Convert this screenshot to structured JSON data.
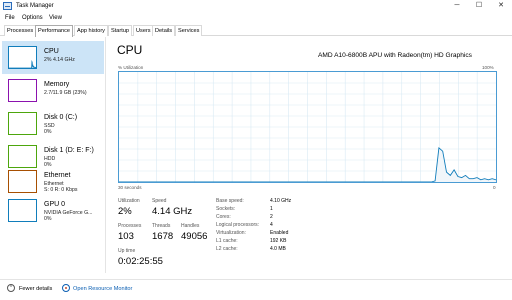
{
  "window": {
    "title": "Task Manager",
    "controls": {
      "minimize": "─",
      "maximize": "☐",
      "close": "✕"
    }
  },
  "menu": [
    "File",
    "Options",
    "View"
  ],
  "tabs": [
    {
      "label": "Processes",
      "active": false
    },
    {
      "label": "Performance",
      "active": true
    },
    {
      "label": "App history",
      "active": false
    },
    {
      "label": "Startup",
      "active": false
    },
    {
      "label": "Users",
      "active": false
    },
    {
      "label": "Details",
      "active": false
    },
    {
      "label": "Services",
      "active": false
    }
  ],
  "sidebar": [
    {
      "title": "CPU",
      "sub": "2% 4.14 GHz",
      "sub2": "",
      "color": "#117dbb",
      "selected": true
    },
    {
      "title": "Memory",
      "sub": "2.7/11.9 GB (23%)",
      "sub2": "",
      "color": "#8b12ae",
      "selected": false
    },
    {
      "title": "Disk 0 (C:)",
      "sub": "SSD",
      "sub2": "0%",
      "color": "#4da60c",
      "selected": false
    },
    {
      "title": "Disk 1 (D: E: F:)",
      "sub": "HDD",
      "sub2": "0%",
      "color": "#4da60c",
      "selected": false
    },
    {
      "title": "Ethernet",
      "sub": "Ethernet",
      "sub2": "S: 0 R: 0 Kbps",
      "color": "#a74f01",
      "selected": false
    },
    {
      "title": "GPU 0",
      "sub": "NVIDIA GeForce G...",
      "sub2": "0%",
      "color": "#117dbb",
      "selected": false
    }
  ],
  "main": {
    "title": "CPU",
    "model": "AMD A10-6800B APU with Radeon(tm) HD Graphics",
    "graph": {
      "y_label": "% Utilization",
      "y_max_label": "100%",
      "x_left_label": "30 seconds",
      "x_right_label": "0",
      "line_color": "#117dbb",
      "fill_color": "#f1f6fa",
      "grid_color": "#d9eaf4",
      "utilization_series": [
        0,
        0,
        0,
        0,
        0,
        0,
        0,
        0,
        0,
        0,
        0,
        0,
        0,
        0,
        0,
        0,
        0,
        0,
        0,
        0,
        0,
        0,
        0,
        0,
        0,
        0,
        0,
        0,
        0,
        0,
        0,
        0,
        0,
        0,
        0,
        0,
        0,
        0,
        0,
        0,
        0,
        0,
        0,
        0,
        0,
        0,
        0,
        0,
        0,
        0,
        0,
        0,
        0,
        0,
        0,
        0,
        0,
        0,
        0,
        0,
        0,
        0,
        0,
        0,
        0,
        0,
        0,
        0,
        0,
        0,
        0,
        0,
        0,
        0,
        0,
        0,
        0,
        0,
        0,
        0,
        0,
        0,
        0,
        1,
        31,
        28,
        9,
        6,
        11,
        5,
        4,
        6,
        3,
        3,
        4,
        2,
        3,
        2,
        3,
        2
      ]
    },
    "stats": {
      "utilization": {
        "label": "Utilization",
        "value": "2%"
      },
      "speed": {
        "label": "Speed",
        "value": "4.14 GHz"
      },
      "processes": {
        "label": "Processes",
        "value": "103"
      },
      "threads": {
        "label": "Threads",
        "value": "1678"
      },
      "handles": {
        "label": "Handles",
        "value": "49056"
      },
      "uptime": {
        "label": "Up time",
        "value": "0:02:25:55"
      }
    },
    "details": [
      {
        "label": "Base speed:",
        "value": "4.10 GHz"
      },
      {
        "label": "Sockets:",
        "value": "1"
      },
      {
        "label": "Cores:",
        "value": "2"
      },
      {
        "label": "Logical processors:",
        "value": "4"
      },
      {
        "label": "Virtualization:",
        "value": "Enabled"
      },
      {
        "label": "L1 cache:",
        "value": "192 KB"
      },
      {
        "label": "L2 cache:",
        "value": "4.0 MB"
      }
    ]
  },
  "footer": {
    "fewer_details": "Fewer details",
    "open_monitor": "Open Resource Monitor"
  }
}
